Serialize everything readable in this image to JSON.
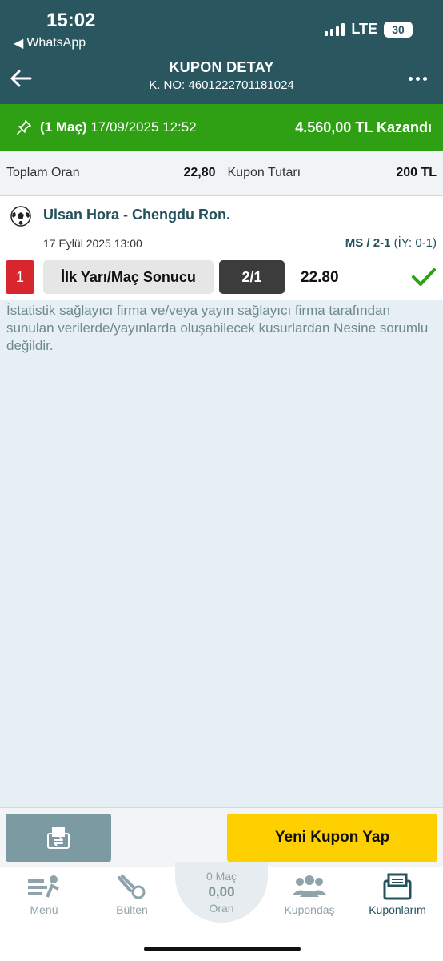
{
  "status_bar": {
    "time": "15:02",
    "back_app": "WhatsApp",
    "network": "LTE",
    "battery": "30"
  },
  "header": {
    "title": "KUPON DETAY",
    "coupon_no": "K. NO: 4601222701181024"
  },
  "result": {
    "match_count": "(1 Maç)",
    "datetime": "17/09/2025 12:52",
    "won_text": "4.560,00 TL Kazandı"
  },
  "summary": {
    "total_odds_label": "Toplam Oran",
    "total_odds_value": "22,80",
    "amount_label": "Kupon Tutarı",
    "amount_value": "200 TL"
  },
  "match": {
    "teams": "Ulsan Hora - Chengdu Ron.",
    "date": "17 Eylül 2025 13:00",
    "score_ms": "MS / 2-1",
    "score_iy": "(İY: 0-1)",
    "row_number": "1",
    "bet_type": "İlk Yarı/Maç Sonucu",
    "pick": "2/1",
    "odd": "22.80"
  },
  "disclaimer": "İstatistik sağlayıcı firma ve/veya yayın sağlayıcı firma tarafından sunulan verilerde/yayınlarda oluşabilecek kusurlardan Nesine sorumlu değildir.",
  "actions": {
    "new_coupon": "Yeni Kupon Yap"
  },
  "tabbar": {
    "menu": "Menü",
    "bulletin": "Bülten",
    "slip_matches": "0 Maç",
    "slip_value": "0,00",
    "slip_label": "Oran",
    "kupondas": "Kupondaş",
    "my_coupons": "Kuponlarım"
  },
  "colors": {
    "header": "#2a5660",
    "won": "#2f9f13",
    "primary_button": "#ffd000",
    "row_badge": "#d8262e"
  }
}
